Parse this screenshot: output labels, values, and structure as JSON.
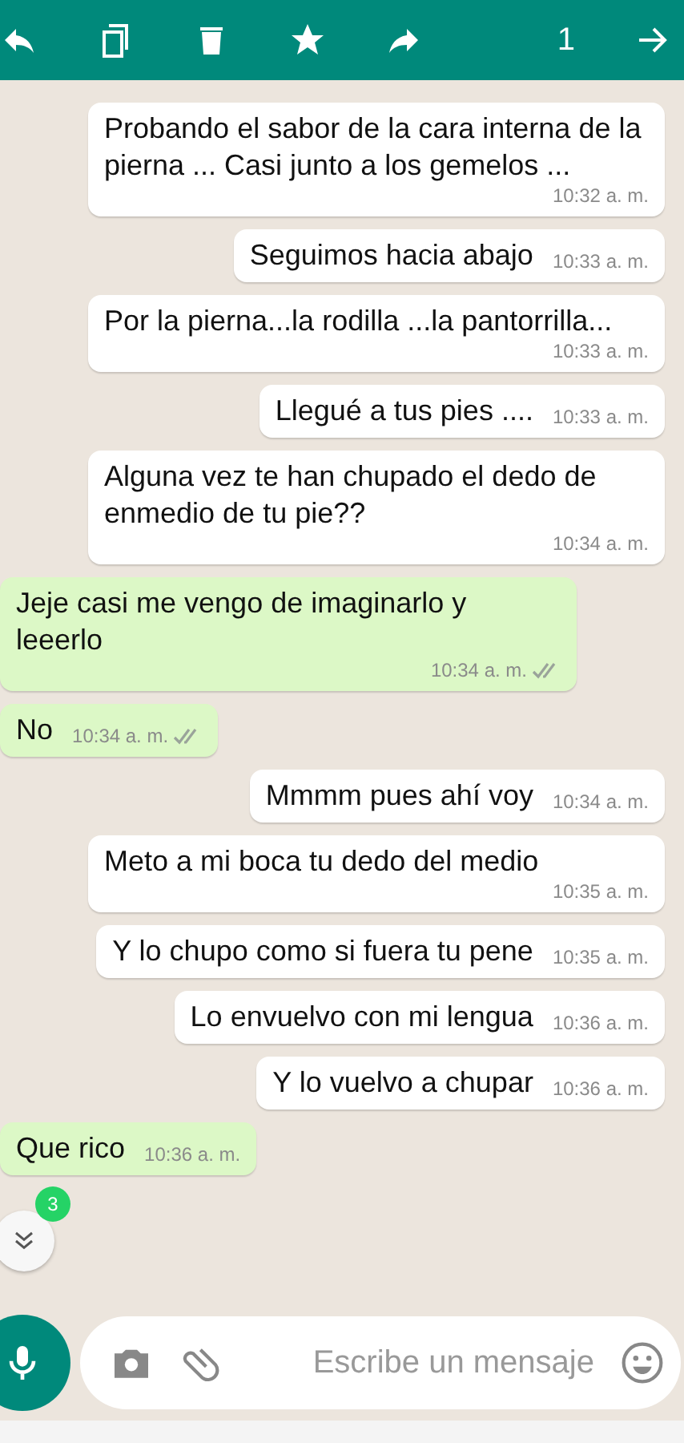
{
  "toolbar": {
    "count": "1"
  },
  "messages": [
    {
      "kind": "in",
      "text": "Probando el sabor de la cara interna de la pierna ... Casi junto a los gemelos ...",
      "time": "10:32 a. m."
    },
    {
      "kind": "in",
      "text": "Seguimos hacia abajo",
      "time": "10:33 a. m."
    },
    {
      "kind": "in",
      "text": "Por la pierna...la rodilla ...la pantorrilla...",
      "time": "10:33 a. m."
    },
    {
      "kind": "in",
      "text": "Llegué a tus pies ....",
      "time": "10:33 a. m."
    },
    {
      "kind": "in",
      "text": "Alguna vez te han chupado el dedo de enmedio de tu pie??",
      "time": "10:34 a. m."
    },
    {
      "kind": "out",
      "text": "Jeje casi me vengo de imaginarlo y leeerlo",
      "time": "10:34 a. m.",
      "read": false
    },
    {
      "kind": "out",
      "text": "No",
      "time": "10:34 a. m.",
      "read": false
    },
    {
      "kind": "in",
      "text": "Mmmm pues ahí voy",
      "time": "10:34 a. m."
    },
    {
      "kind": "in",
      "text": "Meto a mi boca tu dedo del medio",
      "time": "10:35 a. m."
    },
    {
      "kind": "in",
      "text": "Y lo chupo como si fuera tu pene",
      "time": "10:35 a. m."
    },
    {
      "kind": "in",
      "text": "Lo envuelvo con mi lengua",
      "time": "10:36 a. m."
    },
    {
      "kind": "in",
      "text": "Y lo vuelvo a chupar",
      "time": "10:36 a. m."
    },
    {
      "kind": "out",
      "text": "Que rico",
      "time": "10:36 a. m."
    }
  ],
  "unread_badge": "3",
  "composer": {
    "placeholder": "Escribe un mensaje"
  }
}
